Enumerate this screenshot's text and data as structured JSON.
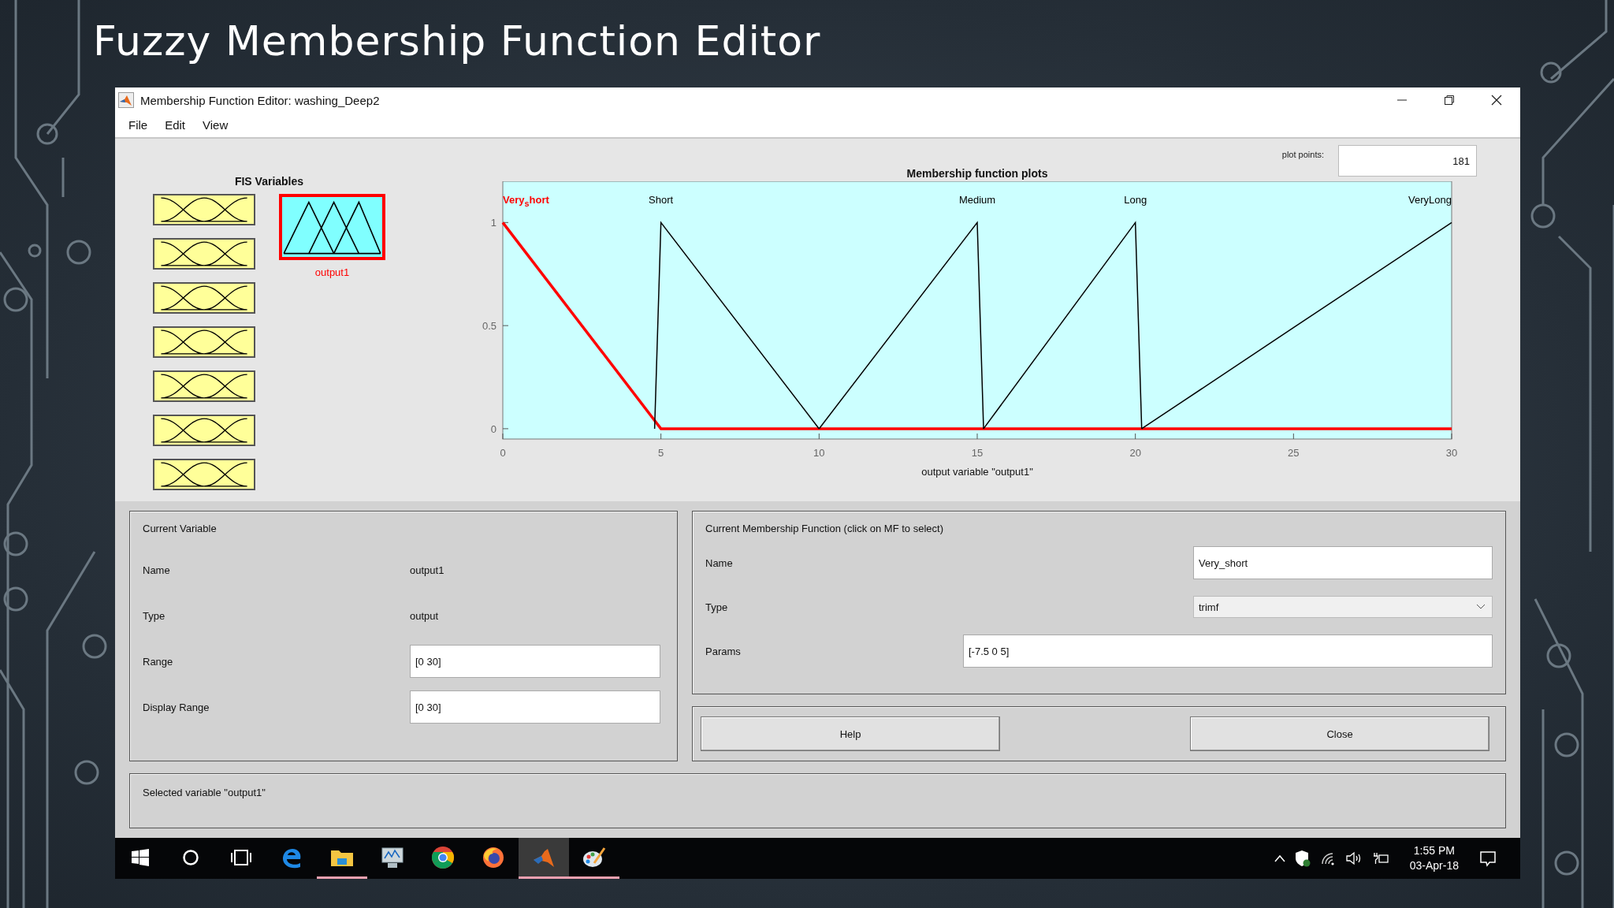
{
  "slide_title": "Fuzzy Membership Function Editor",
  "window": {
    "title": "Membership Function Editor: washing_Deep2"
  },
  "menu": [
    "File",
    "Edit",
    "View"
  ],
  "fis_variables": {
    "title": "FIS Variables",
    "items": [
      {
        "kind": "input",
        "selected": false
      },
      {
        "kind": "input",
        "selected": false
      },
      {
        "kind": "input",
        "selected": false
      },
      {
        "kind": "input",
        "selected": false
      },
      {
        "kind": "input",
        "selected": false
      },
      {
        "kind": "input",
        "selected": false
      },
      {
        "kind": "input",
        "selected": false
      },
      {
        "kind": "output",
        "label": "output1",
        "selected": true
      }
    ]
  },
  "plot": {
    "points_label": "plot points:",
    "points_value": "181",
    "chart_data": {
      "type": "line",
      "title": "Membership function plots",
      "xlabel": "output variable \"output1\"",
      "x": [
        0,
        4.8,
        5,
        10,
        15,
        15.2,
        20,
        20.2,
        25,
        30
      ],
      "series": [
        {
          "name": "Very$_{s}$hort",
          "color": "#ff0000",
          "values": [
            1,
            0.04,
            0,
            0,
            0,
            0,
            0,
            0,
            0,
            0
          ]
        },
        {
          "name": "Short",
          "color": "#000000",
          "values": [
            null,
            0,
            1,
            0,
            null,
            null,
            null,
            null,
            null,
            null
          ]
        },
        {
          "name": "Medium",
          "color": "#000000",
          "values": [
            null,
            null,
            null,
            0,
            1,
            0,
            null,
            null,
            null,
            null
          ]
        },
        {
          "name": "Long",
          "color": "#000000",
          "values": [
            null,
            null,
            null,
            null,
            null,
            0,
            1,
            0,
            null,
            null
          ]
        },
        {
          "name": "VeryLong",
          "color": "#000000",
          "values": [
            null,
            null,
            null,
            null,
            null,
            null,
            null,
            0,
            0.49,
            1
          ]
        }
      ],
      "legend": "top",
      "xlim": [
        0,
        30
      ],
      "ylim": [
        -0.05,
        1.2
      ],
      "xticks": [
        0,
        5,
        10,
        15,
        20,
        25,
        30
      ],
      "yticks": [
        0,
        0.5,
        1
      ]
    }
  },
  "current_variable": {
    "title": "Current Variable",
    "fields": [
      {
        "kind": "text",
        "label": "Name",
        "value": "output1"
      },
      {
        "kind": "text",
        "label": "Type",
        "value": "output"
      },
      {
        "kind": "input",
        "label": "Range",
        "value": "[0 30]"
      },
      {
        "kind": "input",
        "label": "Display Range",
        "value": "[0 30]"
      }
    ]
  },
  "current_mf": {
    "title": "Current Membership Function (click on MF to select)",
    "fields": [
      {
        "kind": "input",
        "label": "Name",
        "value": "Very_short"
      },
      {
        "kind": "select",
        "label": "Type",
        "value": "trimf"
      },
      {
        "kind": "wide",
        "label": "Params",
        "value": "[-7.5 0 5]"
      }
    ]
  },
  "buttons": [
    "Help",
    "Close"
  ],
  "status": "Selected variable \"output1\"",
  "taskbar": {
    "apps": [
      {
        "kind": "start",
        "running": false,
        "active": false
      },
      {
        "kind": "search",
        "running": false,
        "active": false
      },
      {
        "kind": "taskview",
        "running": false,
        "active": false
      },
      {
        "kind": "edge",
        "running": false,
        "active": false
      },
      {
        "kind": "explorer",
        "running": true,
        "active": false
      },
      {
        "kind": "monitor",
        "running": false,
        "active": false
      },
      {
        "kind": "chrome",
        "running": false,
        "active": false
      },
      {
        "kind": "firefox",
        "running": false,
        "active": false
      },
      {
        "kind": "matlab",
        "running": true,
        "active": true
      },
      {
        "kind": "paint",
        "running": true,
        "active": false
      }
    ],
    "time": "1:55 PM",
    "date": "03-Apr-18"
  }
}
